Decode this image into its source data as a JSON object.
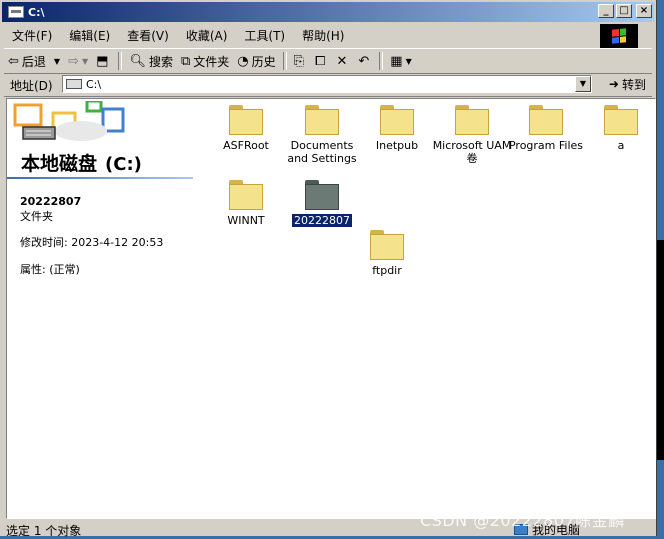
{
  "window": {
    "title": "C:\\"
  },
  "title_buttons": {
    "minimize": "_",
    "maximize": "□",
    "close": "×"
  },
  "menu": [
    "文件(F)",
    "编辑(E)",
    "查看(V)",
    "收藏(A)",
    "工具(T)",
    "帮助(H)"
  ],
  "toolbar": {
    "back": "后退",
    "search": "搜索",
    "folders": "文件夹",
    "history": "历史"
  },
  "address": {
    "label": "地址(D)",
    "value": "C:\\",
    "go": "转到"
  },
  "left_pane": {
    "drive_title": "本地磁盘",
    "drive_letter": "(C:)",
    "selected_name": "20222807",
    "selected_type": "文件夹",
    "modified_label": "修改时间:",
    "modified_value": "2023-4-12 20:53",
    "attr_label": "属性:",
    "attr_value": "(正常)"
  },
  "folders": [
    {
      "name": "ASFRoot",
      "selected": false
    },
    {
      "name": "Documents and Settings",
      "selected": false
    },
    {
      "name": "Inetpub",
      "selected": false
    },
    {
      "name": "Microsoft UAM 卷",
      "selected": false
    },
    {
      "name": "Program Files",
      "selected": false
    },
    {
      "name": "a",
      "selected": false
    },
    {
      "name": "WINNT",
      "selected": false
    },
    {
      "name": "20222807",
      "selected": true
    },
    {
      "name": "ftpdir",
      "selected": false
    }
  ],
  "status": {
    "left": "选定 1 个对象",
    "right": "我的电脑"
  },
  "watermark": "CSDN @20222807陈金麟",
  "colors": {
    "title_bar": "#0a246a",
    "folder": "#f4e38c",
    "selection": "#0a246a"
  }
}
